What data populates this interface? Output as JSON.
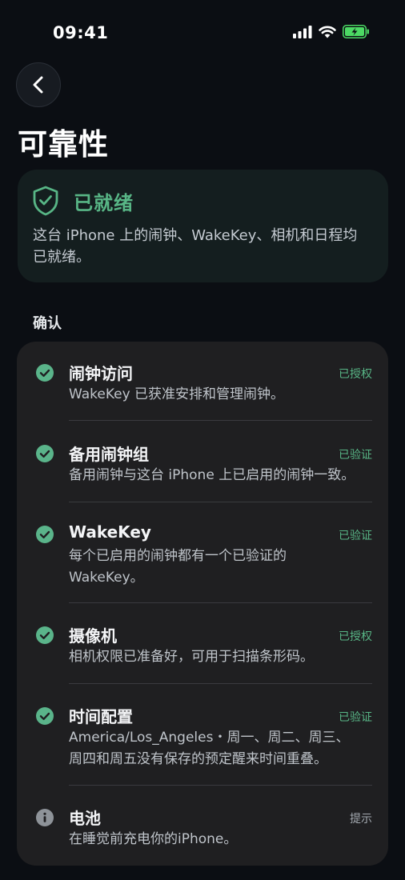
{
  "status_bar": {
    "time": "09:41",
    "icons": [
      "cellular-signal-icon",
      "wifi-icon",
      "battery-charging-icon"
    ],
    "battery_color": "#4cd964"
  },
  "header": {
    "back_icon": "chevron-left-icon",
    "title": "可靠性"
  },
  "ready_card": {
    "icon": "shield-check-icon",
    "title": "已就绪",
    "description": "这台 iPhone 上的闹钟、WakeKey、相机和日程均已就绪。",
    "accent_color": "#58b686"
  },
  "section": {
    "label": "确认"
  },
  "checks": [
    {
      "icon": "check-circle-icon",
      "title": "闹钟访问",
      "status": "已授权",
      "description_lines": [
        "WakeKey 已获准安排和管理闹钟。"
      ]
    },
    {
      "icon": "check-circle-icon",
      "title": "备用闹钟组",
      "status": "已验证",
      "description_lines": [
        "备用闹钟与这台 iPhone 上已启用的闹钟一致。"
      ]
    },
    {
      "icon": "check-circle-icon",
      "title": "WakeKey",
      "status": "已验证",
      "description_lines": [
        "每个已启用的闹钟都有一个已验证的",
        "WakeKey。"
      ]
    },
    {
      "icon": "check-circle-icon",
      "title": "摄像机",
      "status": "已授权",
      "description_lines": [
        "相机权限已准备好，可用于扫描条形码。"
      ]
    },
    {
      "icon": "check-circle-icon",
      "title": "时间配置",
      "status": "已验证",
      "description_lines": [
        "America/Los_Angeles・周一、周二、周三、",
        "周四和周五没有保存的预定醒来时间重叠。"
      ]
    },
    {
      "icon": "info-circle-icon",
      "title": "电池",
      "status": "提示",
      "description_lines": [
        "在睡觉前充电你的iPhone。"
      ]
    }
  ]
}
